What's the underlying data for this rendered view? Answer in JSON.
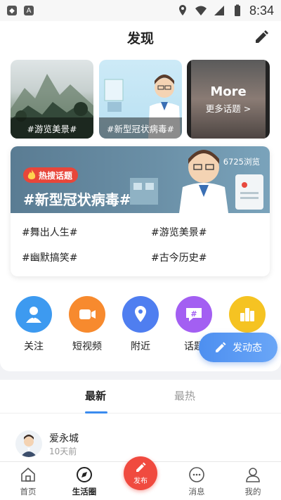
{
  "status_bar": {
    "time": "8:34"
  },
  "header": {
    "title": "发现"
  },
  "topic_tiles": [
    {
      "label": "#游览美景#"
    },
    {
      "label": "#新型冠状病毒#"
    },
    {
      "title": "More",
      "subtitle": "更多话题 >"
    }
  ],
  "hot_topic": {
    "badge": "热搜话题",
    "views": "6725浏览",
    "title": "#新型冠状病毒#",
    "links": [
      "#舞出人生#",
      "#游览美景#",
      "#幽默搞笑#",
      "#古今历史#"
    ]
  },
  "shortcuts": [
    {
      "label": "关注",
      "icon": "follow-icon",
      "color": "#3d9af0"
    },
    {
      "label": "短视频",
      "icon": "video-icon",
      "color": "#f78a2e"
    },
    {
      "label": "附近",
      "icon": "location-icon",
      "color": "#4f7ef0"
    },
    {
      "label": "话题",
      "icon": "hashtag-icon",
      "color": "#a35ff2"
    },
    {
      "label": "",
      "icon": "chart-icon",
      "color": "#f5c322"
    }
  ],
  "post_button": {
    "label": "发动态"
  },
  "feed": {
    "tabs": [
      "最新",
      "最热"
    ],
    "post": {
      "author": "爱永城",
      "time": "10天前"
    }
  },
  "bottom_nav": [
    {
      "label": "首页"
    },
    {
      "label": "生活圈"
    },
    {
      "label": "发布"
    },
    {
      "label": "消息"
    },
    {
      "label": "我的"
    }
  ]
}
